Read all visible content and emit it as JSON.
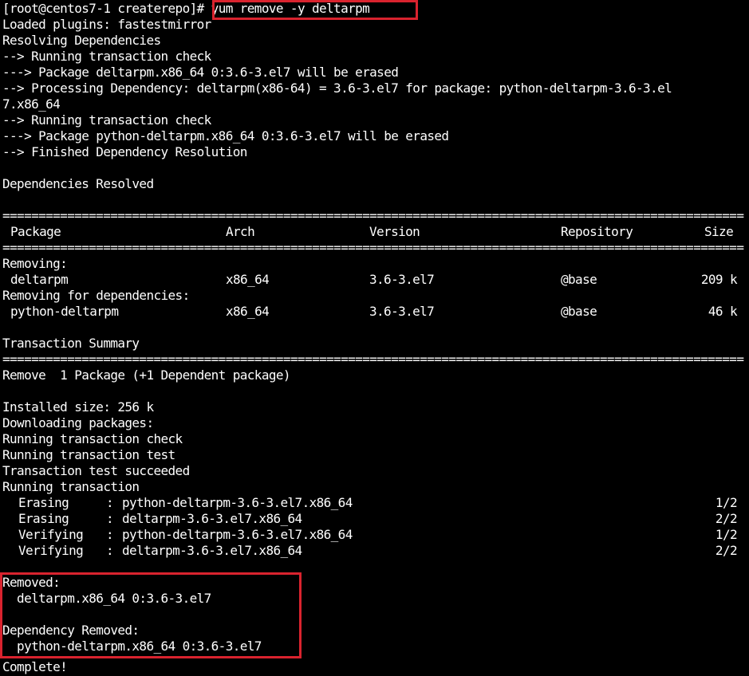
{
  "terminal": {
    "colors": {
      "background": "#000000",
      "text": "#ffffff",
      "highlight": "#d9232e"
    },
    "prompt": "[root@centos7-1 createrepo]",
    "command": "# yum remove -y deltarpm",
    "lines": [
      "Loaded plugins: fastestmirror",
      "Resolving Dependencies",
      "--> Running transaction check",
      "---> Package deltarpm.x86_64 0:3.6-3.el7 will be erased",
      "--> Processing Dependency: deltarpm(x86-64) = 3.6-3.el7 for package: python-deltarpm-3.6-3.el",
      "7.x86_64",
      "--> Running transaction check",
      "---> Package python-deltarpm.x86_64 0:3.6-3.el7 will be erased",
      "--> Finished Dependency Resolution",
      "",
      "Dependencies Resolved",
      ""
    ],
    "rule": "=============================================================================================================",
    "table": {
      "headers": [
        "Package",
        "Arch",
        "Version",
        "Repository",
        "Size"
      ],
      "sections": [
        {
          "title": "Removing:",
          "rows": [
            [
              "deltarpm",
              "x86_64",
              "3.6-3.el7",
              "@base",
              "209 k"
            ]
          ]
        },
        {
          "title": "Removing for dependencies:",
          "rows": [
            [
              "python-deltarpm",
              "x86_64",
              "3.6-3.el7",
              "@base",
              "46 k"
            ]
          ]
        }
      ]
    },
    "summary_title": "Transaction Summary",
    "summary_line": "Remove  1 Package (+1 Dependent package)",
    "progress_lines": [
      "Installed size: 256 k",
      "Downloading packages:",
      "Running transaction check",
      "Running transaction test",
      "Transaction test succeeded",
      "Running transaction"
    ],
    "steps": [
      {
        "action": "Erasing",
        "package": "python-deltarpm-3.6-3.el7.x86_64",
        "progress": "1/2"
      },
      {
        "action": "Erasing",
        "package": "deltarpm-3.6-3.el7.x86_64",
        "progress": "2/2"
      },
      {
        "action": "Verifying",
        "package": "python-deltarpm-3.6-3.el7.x86_64",
        "progress": "1/2"
      },
      {
        "action": "Verifying",
        "package": "deltarpm-3.6-3.el7.x86_64",
        "progress": "2/2"
      }
    ],
    "removed": {
      "title": "Removed:",
      "item": "  deltarpm.x86_64 0:3.6-3.el7",
      "dep_title": "Dependency Removed:",
      "dep_item": "  python-deltarpm.x86_64 0:3.6-3.el7"
    },
    "complete": "Complete!"
  }
}
